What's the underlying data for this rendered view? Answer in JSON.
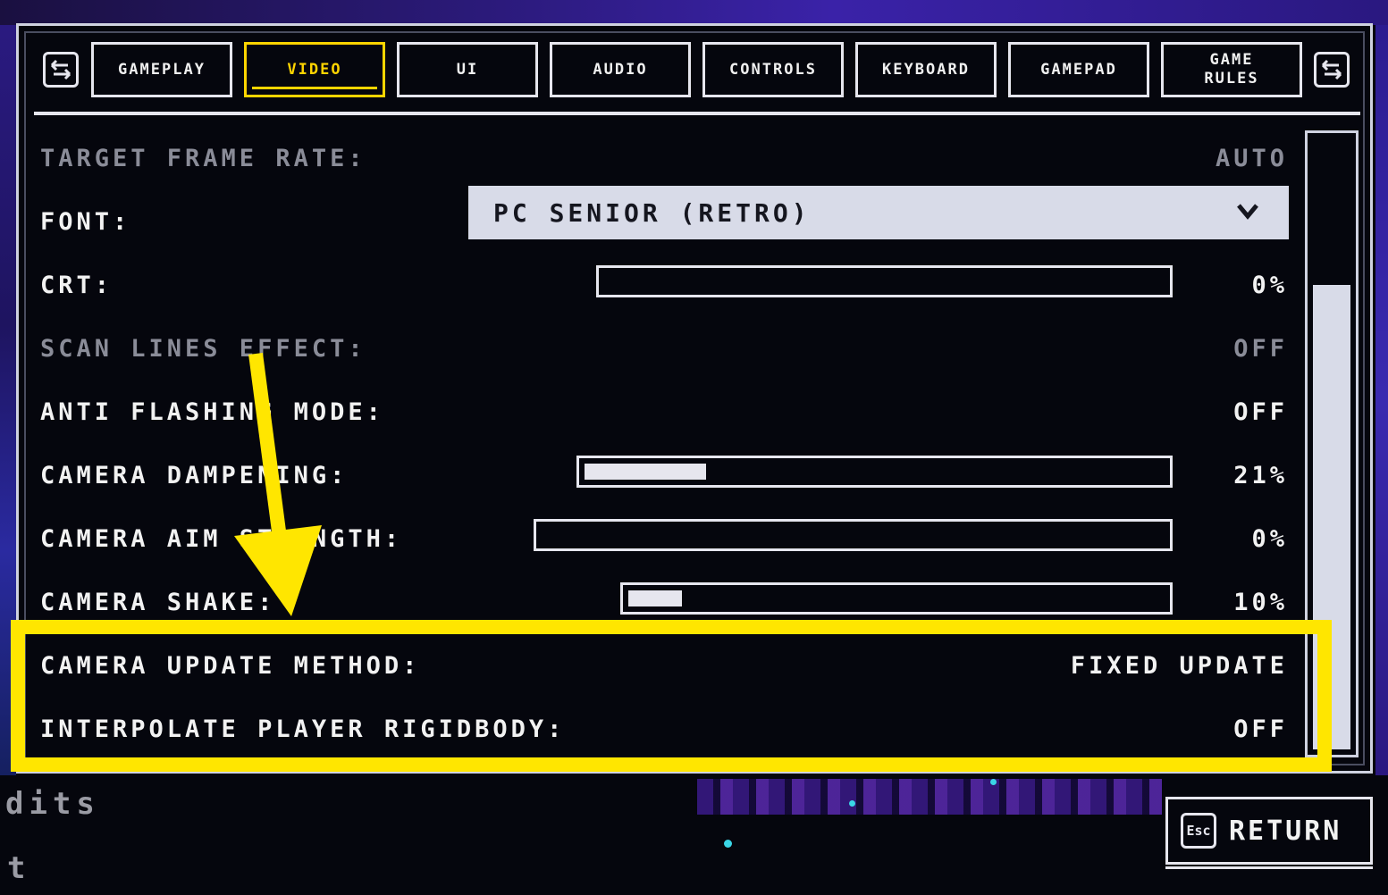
{
  "tabs": [
    {
      "label": "GAMEPLAY",
      "active": false
    },
    {
      "label": "VIDEO",
      "active": true
    },
    {
      "label": "UI",
      "active": false
    },
    {
      "label": "AUDIO",
      "active": false
    },
    {
      "label": "CONTROLS",
      "active": false
    },
    {
      "label": "KEYBOARD",
      "active": false
    },
    {
      "label": "GAMEPAD",
      "active": false
    },
    {
      "label": "GAME\nRULES",
      "active": false
    }
  ],
  "settings": {
    "target_frame_rate": {
      "label": "TARGET FRAME RATE:",
      "value": "AUTO"
    },
    "font": {
      "label": "FONT:",
      "value": "PC SENIOR (RETRO)"
    },
    "crt": {
      "label": "CRT:",
      "value": "0%",
      "level": 0
    },
    "scan_lines": {
      "label": "SCAN LINES EFFECT:",
      "value": "OFF"
    },
    "anti_flashing": {
      "label": "ANTI FLASHING MODE:",
      "value": "OFF"
    },
    "camera_dampening": {
      "label": "CAMERA DAMPENING:",
      "value": "21%",
      "level": 0.21
    },
    "camera_aim_strength": {
      "label": "CAMERA AIM STRENGTH:",
      "value": "0%",
      "level": 0
    },
    "camera_shake": {
      "label": "CAMERA SHAKE:",
      "value": "10%",
      "level": 0.1
    },
    "camera_update_method": {
      "label": "CAMERA UPDATE METHOD:",
      "value": "FIXED UPDATE"
    },
    "interpolate_rigidbody": {
      "label": "INTERPOLATE PLAYER RIGIDBODY:",
      "value": "OFF"
    }
  },
  "scrollbar": {
    "position": 0.24,
    "visible_fraction": 0.76
  },
  "return_button": {
    "key": "Esc",
    "label": "RETURN"
  },
  "background_text": {
    "line1": "dits",
    "line2": "t"
  },
  "colors": {
    "accent": "#ffd400",
    "highlight": "#ffe600",
    "panel_border": "#cfd2e0"
  },
  "icons": {
    "tab_prev": "swap-arrows-icon",
    "tab_next": "swap-arrows-icon",
    "font_dropdown": "chevron-down-icon",
    "esc": "esc-key-icon"
  }
}
